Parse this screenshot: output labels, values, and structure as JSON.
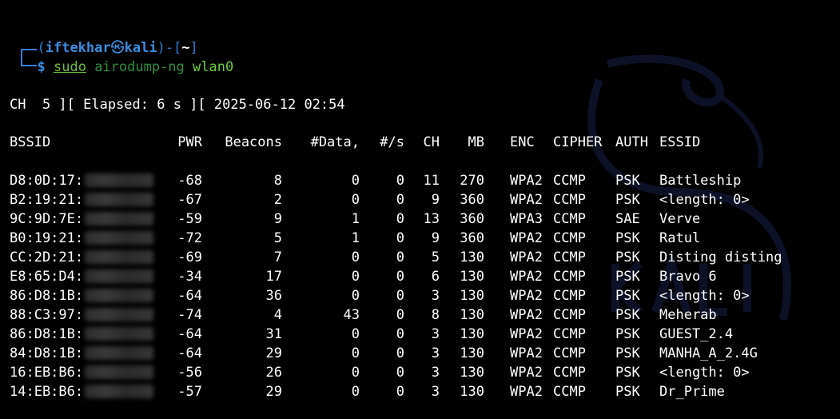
{
  "colors": {
    "background": "#000000",
    "prompt_blue": "#2f7fd4",
    "user_blue": "#3b8ee0",
    "command_green": "#6bd03a",
    "text": "#ffffff"
  },
  "prompt": {
    "open_paren": "(",
    "user": "iftekhar",
    "at_symbol": "㉿",
    "host": "kali",
    "close_paren": ")-[",
    "cwd": "~",
    "close_bracket": "]",
    "dollar": "$",
    "command_sudo": "sudo",
    "command_program": "airodump-ng",
    "command_arg": "wlan0"
  },
  "status": {
    "line": "CH  5 ][ Elapsed: 6 s ][ 2025-06-12 02:54"
  },
  "table": {
    "headers": {
      "bssid": "BSSID",
      "pwr": "PWR",
      "beacons": "Beacons",
      "data": "#Data,",
      "rate": "#/s",
      "ch": "CH",
      "mb": "MB",
      "enc": "ENC",
      "cipher": "CIPHER",
      "auth": "AUTH",
      "essid": "ESSID"
    },
    "rows": [
      {
        "bssid": "D8:0D:17:",
        "pwr": "-68",
        "beacons": "8",
        "data": "0",
        "rate": "0",
        "ch": "11",
        "mb": "270",
        "enc": "WPA2",
        "cipher": "CCMP",
        "auth": "PSK",
        "essid": "Battleship"
      },
      {
        "bssid": "B2:19:21:",
        "pwr": "-67",
        "beacons": "2",
        "data": "0",
        "rate": "0",
        "ch": "9",
        "mb": "360",
        "enc": "WPA2",
        "cipher": "CCMP",
        "auth": "PSK",
        "essid": "<length:  0>"
      },
      {
        "bssid": "9C:9D:7E:",
        "pwr": "-59",
        "beacons": "9",
        "data": "1",
        "rate": "0",
        "ch": "13",
        "mb": "360",
        "enc": "WPA3",
        "cipher": "CCMP",
        "auth": "SAE",
        "essid": "Verve"
      },
      {
        "bssid": "B0:19:21:",
        "pwr": "-72",
        "beacons": "5",
        "data": "1",
        "rate": "0",
        "ch": "9",
        "mb": "360",
        "enc": "WPA2",
        "cipher": "CCMP",
        "auth": "PSK",
        "essid": "Ratul"
      },
      {
        "bssid": "CC:2D:21:",
        "pwr": "-69",
        "beacons": "7",
        "data": "0",
        "rate": "0",
        "ch": "5",
        "mb": "130",
        "enc": "WPA2",
        "cipher": "CCMP",
        "auth": "PSK",
        "essid": "Disting disting"
      },
      {
        "bssid": "E8:65:D4:",
        "pwr": "-34",
        "beacons": "17",
        "data": "0",
        "rate": "0",
        "ch": "6",
        "mb": "130",
        "enc": "WPA2",
        "cipher": "CCMP",
        "auth": "PSK",
        "essid": "Bravo 6"
      },
      {
        "bssid": "86:D8:1B:",
        "pwr": "-64",
        "beacons": "36",
        "data": "0",
        "rate": "0",
        "ch": "3",
        "mb": "130",
        "enc": "WPA2",
        "cipher": "CCMP",
        "auth": "PSK",
        "essid": "<length:  0>"
      },
      {
        "bssid": "88:C3:97:",
        "pwr": "-74",
        "beacons": "4",
        "data": "43",
        "rate": "0",
        "ch": "8",
        "mb": "130",
        "enc": "WPA2",
        "cipher": "CCMP",
        "auth": "PSK",
        "essid": "Meherab"
      },
      {
        "bssid": "86:D8:1B:",
        "pwr": "-64",
        "beacons": "31",
        "data": "0",
        "rate": "0",
        "ch": "3",
        "mb": "130",
        "enc": "WPA2",
        "cipher": "CCMP",
        "auth": "PSK",
        "essid": "GUEST_2.4"
      },
      {
        "bssid": "84:D8:1B:",
        "pwr": "-64",
        "beacons": "29",
        "data": "0",
        "rate": "0",
        "ch": "3",
        "mb": "130",
        "enc": "WPA2",
        "cipher": "CCMP",
        "auth": "PSK",
        "essid": "MANHA_A_2.4G"
      },
      {
        "bssid": "16:EB:B6:",
        "pwr": "-56",
        "beacons": "26",
        "data": "0",
        "rate": "0",
        "ch": "3",
        "mb": "130",
        "enc": "WPA2",
        "cipher": "CCMP",
        "auth": "PSK",
        "essid": "<length:  0>"
      },
      {
        "bssid": "14:EB:B6:",
        "pwr": "-57",
        "beacons": "29",
        "data": "0",
        "rate": "0",
        "ch": "3",
        "mb": "130",
        "enc": "WPA2",
        "cipher": "CCMP",
        "auth": "PSK",
        "essid": "Dr_Prime"
      }
    ]
  }
}
